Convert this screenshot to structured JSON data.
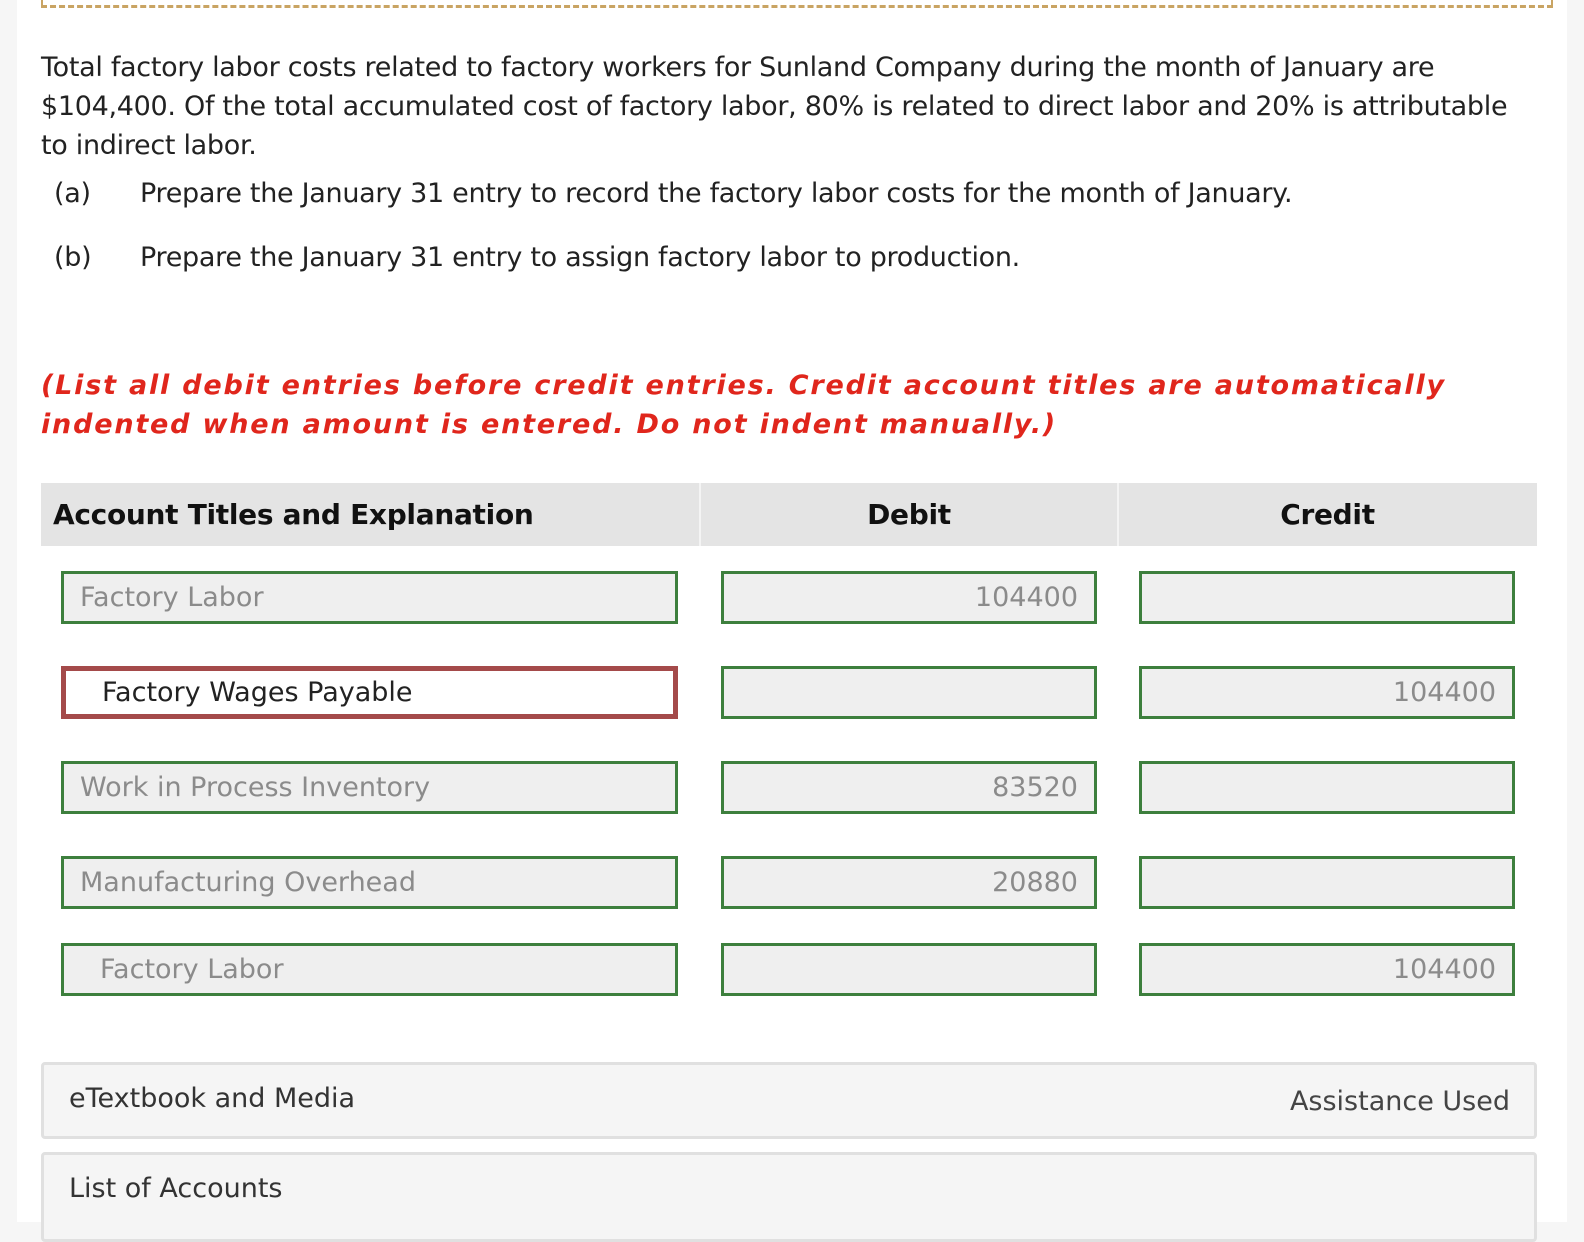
{
  "problem": {
    "intro": "Total factory labor costs related to factory workers for Sunland Company during the month of January are $104,400. Of the total accumulated cost of factory labor, 80% is related to direct labor and 20% is attributable to indirect labor.",
    "parts": [
      {
        "letter": "(a)",
        "text": "Prepare the January 31 entry to record the factory labor costs for the month of January."
      },
      {
        "letter": "(b)",
        "text": "Prepare the January 31 entry to assign factory labor to production."
      }
    ],
    "instruction": "(List all debit entries before credit entries. Credit account titles are automatically indented when amount is entered. Do not indent manually.)"
  },
  "journal": {
    "headers": {
      "account": "Account Titles and Explanation",
      "debit": "Debit",
      "credit": "Credit"
    },
    "rows": [
      {
        "account": "Factory Labor",
        "debit": "104400",
        "credit": ""
      },
      {
        "account": "Factory Wages Payable",
        "debit": "",
        "credit": "104400"
      },
      {
        "account": "Work in Process Inventory",
        "debit": "83520",
        "credit": ""
      },
      {
        "account": "Manufacturing Overhead",
        "debit": "20880",
        "credit": ""
      },
      {
        "account": "Factory Labor",
        "debit": "",
        "credit": "104400"
      }
    ]
  },
  "panels": {
    "media_label": "eTextbook and Media",
    "assistance_label": "Assistance Used",
    "accounts_label": "List of Accounts"
  },
  "colors": {
    "instruction": "#e0261c",
    "field_border": "#3d7f3d",
    "active_field_border": "#a44a4a",
    "header_bg": "#e4e4e4"
  }
}
